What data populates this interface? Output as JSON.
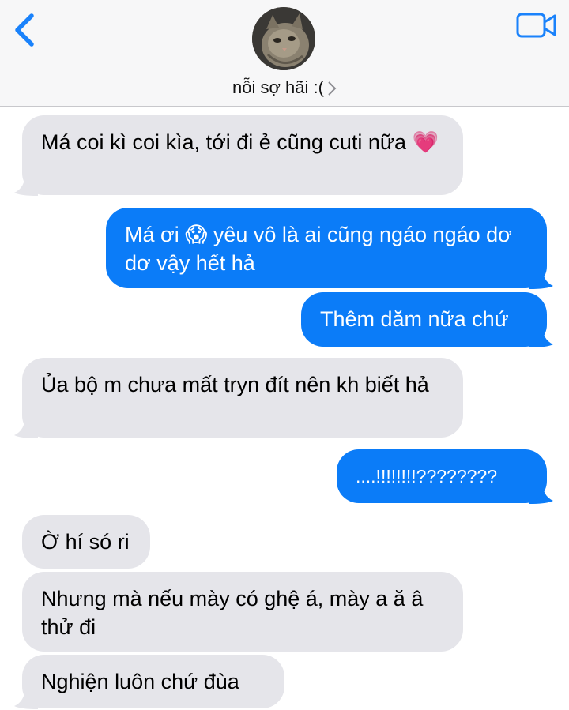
{
  "header": {
    "contact_name": "nỗi sợ hãi :(",
    "icons": {
      "back": "chevron-left-icon",
      "video": "video-camera-icon",
      "details": "chevron-right-icon"
    },
    "accent_color": "#1a82fb"
  },
  "messages": [
    {
      "side": "in",
      "text": "Má coi kì coi kìa, tới đi ẻ cũng cuti nữa",
      "emoji": "💗"
    },
    {
      "side": "out",
      "text": "Má ơi 😱 yêu vô là ai cũng ngáo ngáo dơ dơ vậy hết hả"
    },
    {
      "side": "out",
      "text": "Thêm dăm nữa chứ"
    },
    {
      "side": "in",
      "text": "Ủa bộ m chưa mất tryn đít nên kh biết hả"
    },
    {
      "side": "out",
      "text": "....!!!!!!!!????????"
    },
    {
      "side": "in",
      "text": "Ờ hí só ri"
    },
    {
      "side": "in",
      "text": "Nhưng mà nếu mày có ghệ á, mày a ă â thử đi"
    },
    {
      "side": "in",
      "text": "Nghiện luôn chứ đùa"
    }
  ],
  "colors": {
    "incoming": "#e5e5ea",
    "outgoing": "#0b7cf8"
  }
}
